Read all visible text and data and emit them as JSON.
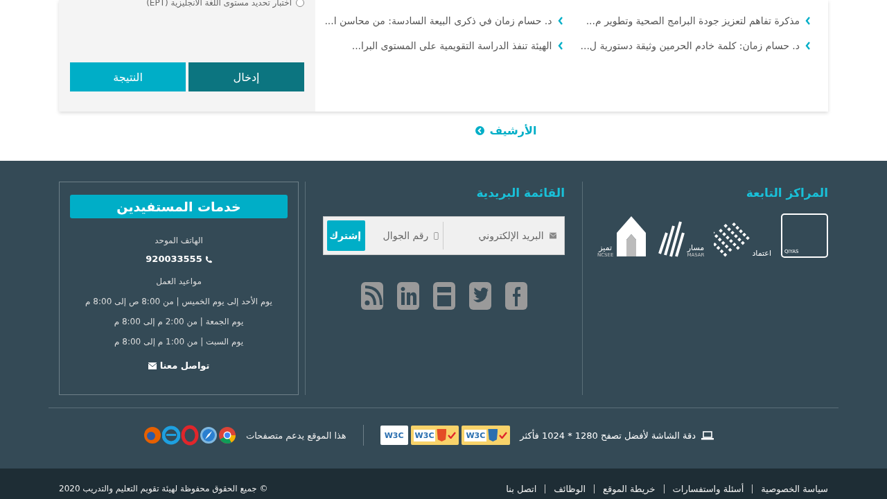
{
  "exam_panel": {
    "option": {
      "label": "اختبار تحديد مستوى اللغة الانجليزية (EPT)",
      "selected": false
    },
    "buttons": [
      {
        "label": "إدخال",
        "kind": "primary"
      },
      {
        "label": "النتيجة",
        "kind": "secondary"
      }
    ]
  },
  "news": [
    {
      "title": "مذكرة تفاهم لتعزيز جودة البرامج الصحية وتطوير م..."
    },
    {
      "title": "د. حسام زمان في ذكرى البيعة السادسة: من محاسن ا..."
    },
    {
      "title": "د. حسام زمان: كلمة خادم الحرمين وثيقة دستورية ل..."
    },
    {
      "title": "الهيئة تنفذ الدراسة التقويمية على المستوى البرا..."
    }
  ],
  "archive_link": "الأرشيف",
  "centers": {
    "title": "المراكز التابعة",
    "logos": [
      {
        "kind": "qiyas",
        "name": "QIYAS"
      },
      {
        "kind": "etimad",
        "name": "اعتماد"
      },
      {
        "kind": "masar",
        "name": "مسار",
        "sub": "MASAR"
      },
      {
        "kind": "tamayuz",
        "name": "تميز",
        "sub": "NCSEE"
      }
    ]
  },
  "mailing_list": {
    "title": "القائمة البريدية",
    "email_placeholder": "البريد الإلكتروني",
    "phone_placeholder": "رقم الجوال",
    "subscribe": "إشترك"
  },
  "services": {
    "title": "خدمات المستفيدين",
    "phone_label": "الهاتف الموحد",
    "phone": "920033555",
    "hours_label": "مواعيد العمل",
    "hours": [
      "يوم الأحد إلى يوم الخميس | من 8:00 ص إلى 8:00 م",
      "يوم الجمعة | من 2:00 م إلى 8:00 م",
      "يوم السبت | من 1:00 م إلى 8:00 م"
    ],
    "contact": "تواصل معنا"
  },
  "resolution_note": "دقة الشاشة لأفضل تصفح 1280 * 1024 فأكثر",
  "badges": [
    {
      "kind": "css",
      "label": "W3C"
    },
    {
      "kind": "html",
      "label": "W3C"
    },
    {
      "kind": "plain",
      "label": "W3C"
    }
  ],
  "browsers_note": "هذا الموقع يدعم متصفحات",
  "bottom_links": [
    "سياسة الخصوصية",
    "أسئلة واستفسارات",
    "خريطة الموقع",
    "الوظائف",
    "اتصل بنا"
  ],
  "copyright": "© جميع الحقوق محفوظة لهيئة تقويم التعليم والتدريب 2020"
}
